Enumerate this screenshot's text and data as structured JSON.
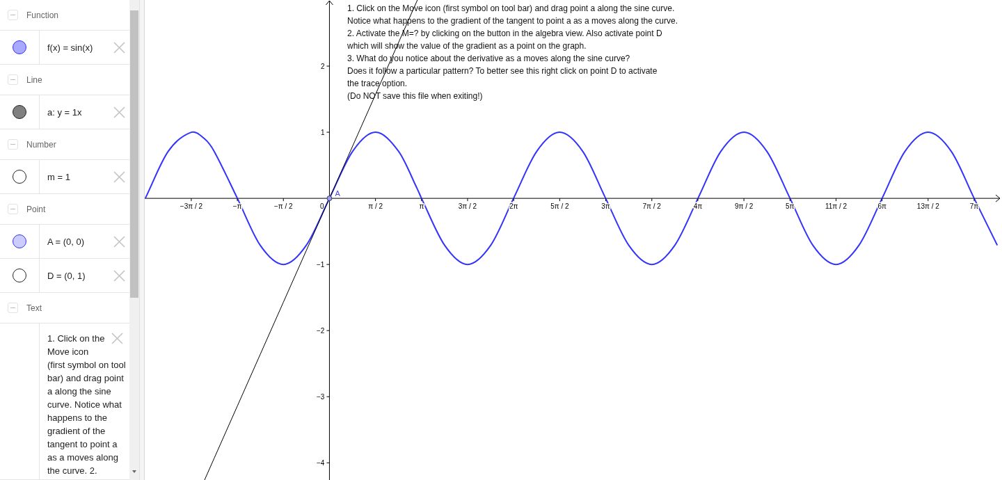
{
  "categories": [
    {
      "label": "Function",
      "expanded": true,
      "items": [
        {
          "kind": "object",
          "expression": "f(x) = sin(x)",
          "visible": true,
          "color": "#a9a9ff"
        }
      ]
    },
    {
      "label": "Line",
      "expanded": true,
      "items": [
        {
          "kind": "object",
          "expression": "a: y = 1x",
          "visible": true,
          "color": "#808080"
        }
      ]
    },
    {
      "label": "Number",
      "expanded": true,
      "items": [
        {
          "kind": "object",
          "expression": "m = 1",
          "visible": false
        }
      ]
    },
    {
      "label": "Point",
      "expanded": true,
      "items": [
        {
          "kind": "object",
          "expression": "A = (0, 0)",
          "visible": true,
          "color": "#ccccff"
        },
        {
          "kind": "object",
          "expression": "D = (0, 1)",
          "visible": false
        }
      ]
    },
    {
      "label": "Text",
      "expanded": true,
      "items": [
        {
          "kind": "text",
          "expression": "1. Click on the Move icon (first symbol on tool bar) and drag point a along the sine curve. Notice what happens to the gradient of the tangent to point a as a moves along the curve. 2."
        }
      ]
    }
  ],
  "graph": {
    "text_lines": [
      "1. Click on the Move icon (first symbol on tool bar) and drag point a along the sine curve.",
      "Notice what happens to the gradient of the tangent to point a as a moves along the curve.",
      "2. Activate the M=? by clicking on the button in the algebra view. Also activate point D",
      "which will show the value of the gradient as a point on the graph.",
      "3. What do you notice about the derivative as a moves along the sine curve?",
      "Does it follow a particular pattern? To better see this right click on point D to activate",
      "the trace option.",
      "(Do NOT save this file when exiting!)"
    ],
    "point": {
      "label": "A",
      "color": "#9999ff"
    },
    "origin_label": "0",
    "chart_data": {
      "type": "line",
      "xlim": [
        -6.3,
        22.94
      ],
      "ylim": [
        -4.26,
        3.0
      ],
      "x": [
        -6.28,
        -5.5,
        -4.71,
        -4.26,
        -3.93,
        -3.14,
        -2.36,
        -1.57,
        -0.79,
        0,
        0.79,
        1.57,
        2.36,
        3.0,
        3.14,
        3.93,
        4.71,
        5.5,
        6.28,
        7.07,
        7.85,
        8.64,
        9.42,
        10.21,
        11.0,
        11.78,
        12.57,
        13.35,
        14.14,
        14.92,
        15.71,
        16.49,
        17.28,
        18.06,
        18.85,
        19.63,
        20.42,
        21.21,
        21.99,
        22.78
      ],
      "series": [
        {
          "color": "#3333ff",
          "values": [
            0,
            0.71,
            1,
            0.9,
            0.71,
            0,
            -0.71,
            -1,
            -0.71,
            0,
            0.71,
            1,
            0.71,
            0.14,
            0,
            -0.71,
            -1,
            -0.71,
            0,
            0.71,
            1,
            0.71,
            0,
            -0.71,
            -1,
            -0.71,
            0,
            0.71,
            1,
            0.71,
            0,
            -0.71,
            -1,
            -0.71,
            0,
            0.71,
            1,
            0.71,
            0,
            -0.71
          ]
        },
        {
          "color": "#000000",
          "values": [
            null,
            null,
            null,
            -4.26,
            -3.93,
            -3.14,
            -2.36,
            -1.57,
            -0.79,
            0,
            0.79,
            1.57,
            2.36,
            3.0,
            null,
            null,
            null,
            null,
            null,
            null,
            null,
            null,
            null,
            null,
            null,
            null,
            null,
            null,
            null,
            null,
            null,
            null,
            null,
            null,
            null,
            null,
            null,
            null,
            null,
            null
          ]
        }
      ],
      "xticks": [
        {
          "value": -4.712,
          "label": "−3π / 2"
        },
        {
          "value": -3.142,
          "label": "−π"
        },
        {
          "value": -1.571,
          "label": "−π / 2"
        },
        {
          "value": 1.571,
          "label": "π / 2"
        },
        {
          "value": 3.142,
          "label": "π"
        },
        {
          "value": 4.712,
          "label": "3π / 2"
        },
        {
          "value": 6.283,
          "label": "2π"
        },
        {
          "value": 7.854,
          "label": "5π / 2"
        },
        {
          "value": 9.425,
          "label": "3π"
        },
        {
          "value": 10.996,
          "label": "7π / 2"
        },
        {
          "value": 12.566,
          "label": "4π"
        },
        {
          "value": 14.137,
          "label": "9π / 2"
        },
        {
          "value": 15.708,
          "label": "5π"
        },
        {
          "value": 17.279,
          "label": "11π / 2"
        },
        {
          "value": 18.85,
          "label": "6π"
        },
        {
          "value": 20.42,
          "label": "13π / 2"
        },
        {
          "value": 21.991,
          "label": "7π"
        }
      ],
      "yticks": [
        {
          "value": 2,
          "label": "2"
        },
        {
          "value": 1,
          "label": "1"
        },
        {
          "value": -1,
          "label": "−1"
        },
        {
          "value": -2,
          "label": "−2"
        },
        {
          "value": -3,
          "label": "−3"
        },
        {
          "value": -4,
          "label": "−4"
        }
      ]
    }
  }
}
